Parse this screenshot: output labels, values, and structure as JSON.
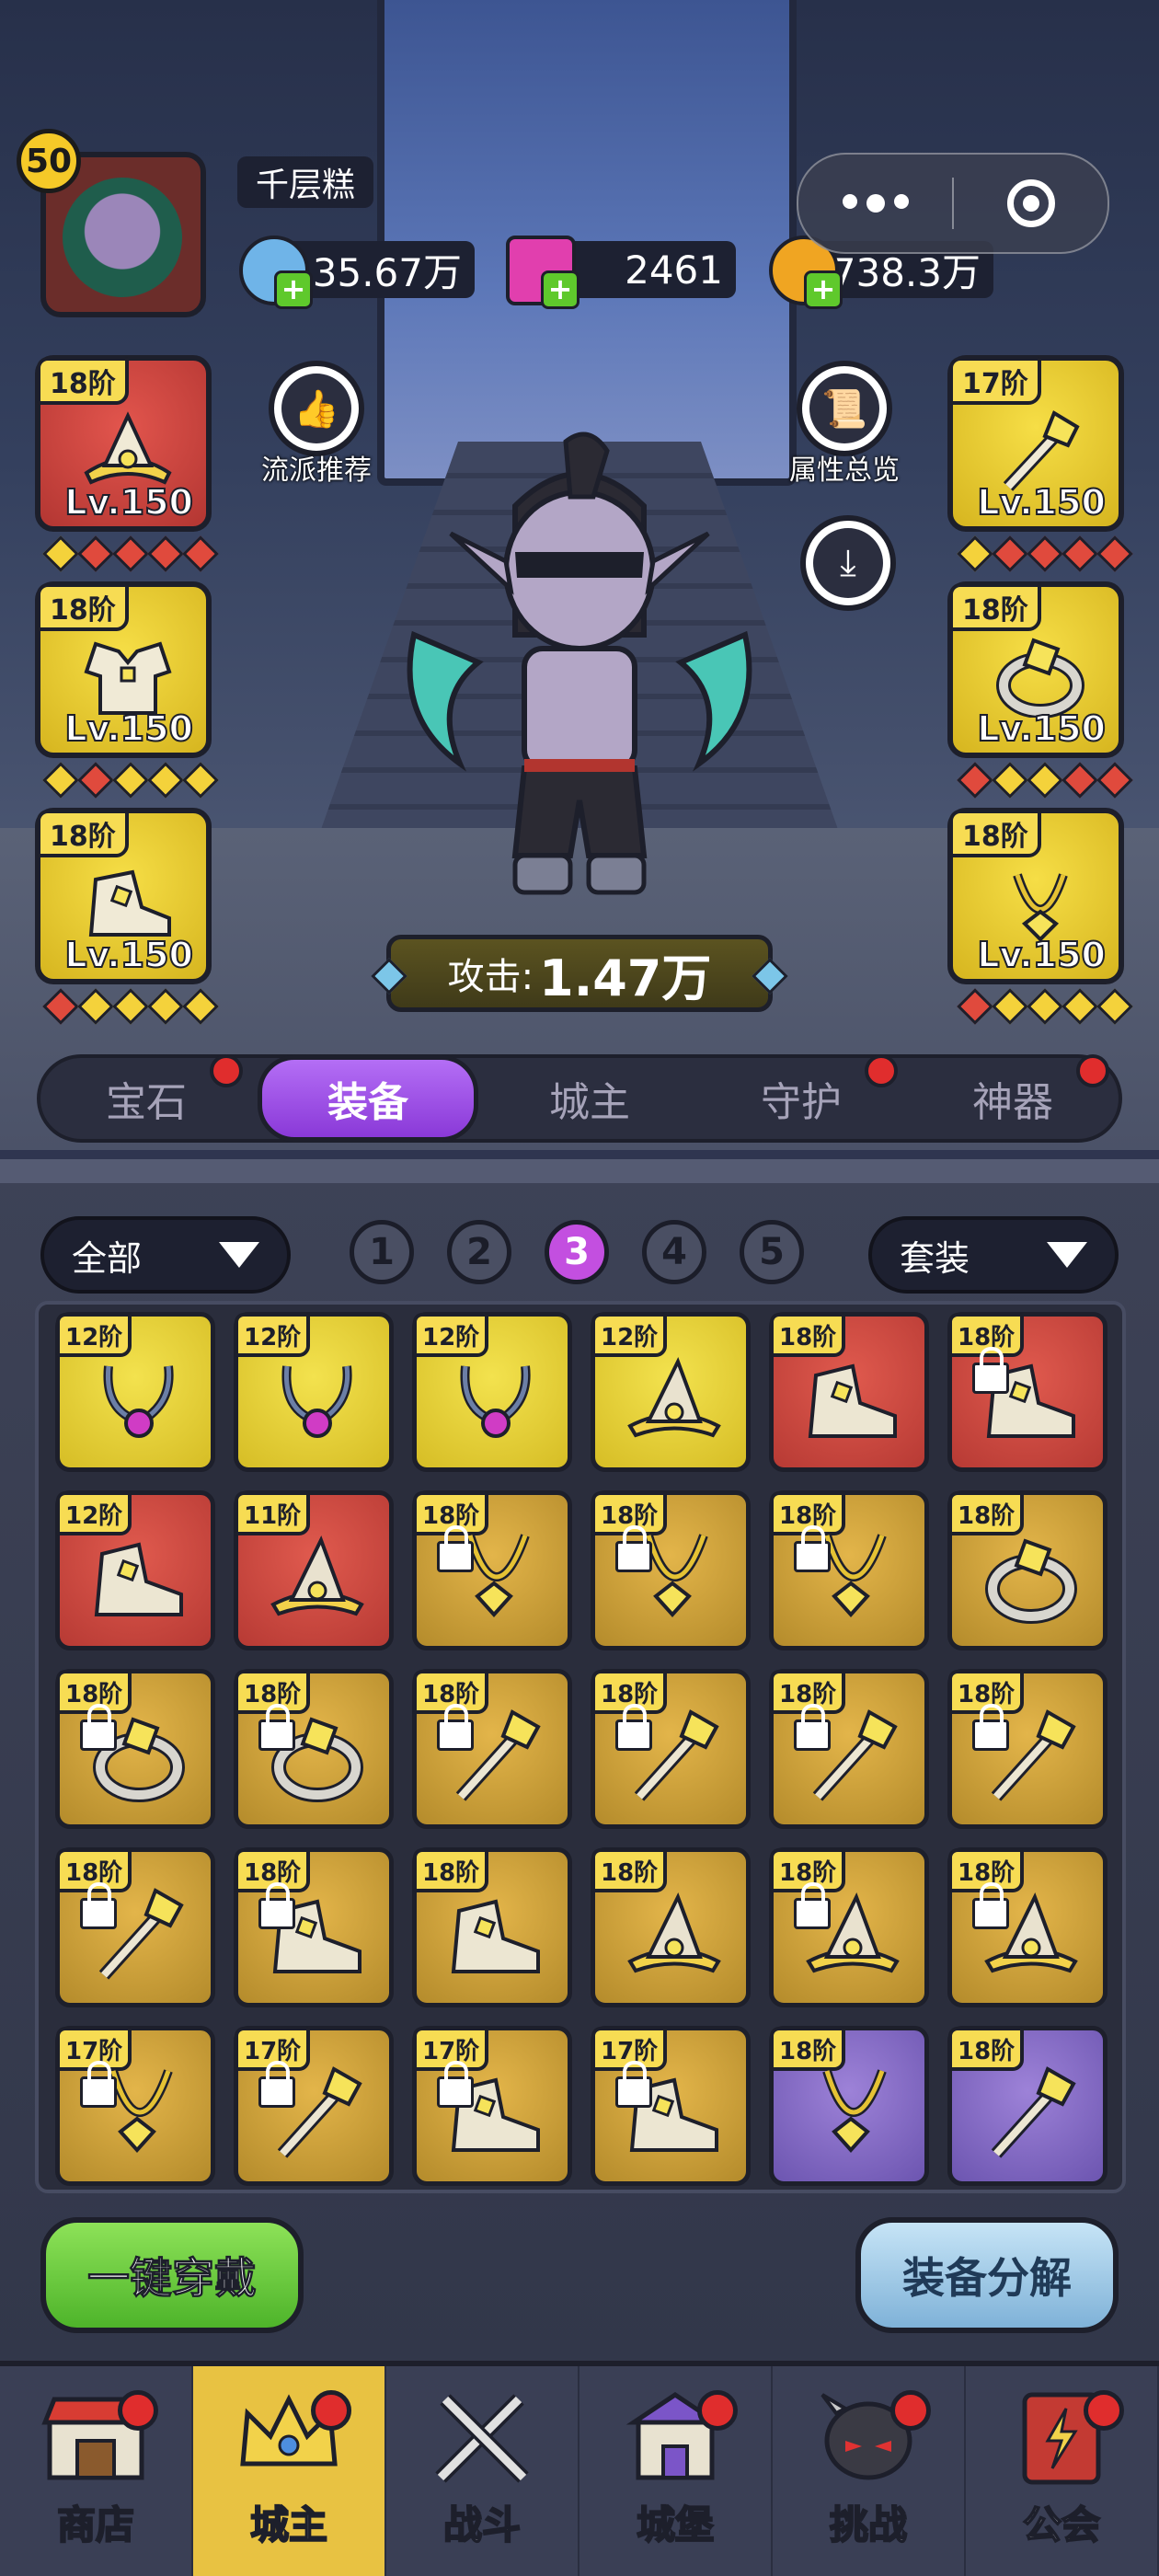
{
  "player": {
    "level": "50",
    "name": "千层糕"
  },
  "currencies": [
    {
      "name": "crystal",
      "value": "35.67万",
      "icon": "crystal-icon",
      "color": "#6fb4e8"
    },
    {
      "name": "gem",
      "value": "2461",
      "icon": "pink-gem-icon",
      "color": "#e13fae"
    },
    {
      "name": "gold",
      "value": "738.3万",
      "icon": "gold-coin-icon",
      "color": "#f0a522"
    }
  ],
  "buttons": {
    "recommend": "流派推荐",
    "attributes": "属性总览"
  },
  "left_slots": [
    {
      "tier": "18阶",
      "level": "Lv.150",
      "color": "red",
      "icon": "hat-icon",
      "gems": [
        "y",
        "r",
        "r",
        "r",
        "r"
      ]
    },
    {
      "tier": "18阶",
      "level": "Lv.150",
      "color": "yellow",
      "icon": "armor-icon",
      "gems": [
        "y",
        "r",
        "y",
        "y",
        "y"
      ]
    },
    {
      "tier": "18阶",
      "level": "Lv.150",
      "color": "yellow",
      "icon": "boots-icon",
      "gems": [
        "r",
        "y",
        "y",
        "y",
        "y"
      ]
    }
  ],
  "right_slots": [
    {
      "tier": "17阶",
      "level": "Lv.150",
      "color": "yellow",
      "icon": "staff-icon",
      "gems": [
        "y",
        "r",
        "r",
        "r",
        "r"
      ]
    },
    {
      "tier": "18阶",
      "level": "Lv.150",
      "color": "yellow",
      "icon": "ring-icon",
      "gems": [
        "r",
        "y",
        "y",
        "r",
        "r"
      ]
    },
    {
      "tier": "18阶",
      "level": "Lv.150",
      "color": "yellow",
      "icon": "necklace-icon",
      "gems": [
        "r",
        "y",
        "y",
        "y",
        "y"
      ]
    }
  ],
  "attack": {
    "label": "攻击:",
    "value": "1.47万"
  },
  "tabs": [
    {
      "label": "宝石",
      "active": false,
      "dot": true
    },
    {
      "label": "装备",
      "active": true,
      "dot": false
    },
    {
      "label": "城主",
      "active": false,
      "dot": false
    },
    {
      "label": "守护",
      "active": false,
      "dot": true
    },
    {
      "label": "神器",
      "active": false,
      "dot": true
    }
  ],
  "filters": {
    "left": "全部",
    "right": "套装"
  },
  "pages": [
    "1",
    "2",
    "3",
    "4",
    "5"
  ],
  "active_page": "3",
  "inventory": [
    {
      "tier": "12阶",
      "color": "yellow",
      "icon": "pendant-icon",
      "lock": false
    },
    {
      "tier": "12阶",
      "color": "yellow",
      "icon": "pendant-icon",
      "lock": false
    },
    {
      "tier": "12阶",
      "color": "yellow",
      "icon": "pendant-icon",
      "lock": false
    },
    {
      "tier": "12阶",
      "color": "yellow",
      "icon": "hat-icon",
      "lock": false
    },
    {
      "tier": "18阶",
      "color": "red",
      "icon": "boots-icon",
      "lock": false
    },
    {
      "tier": "18阶",
      "color": "red",
      "icon": "boots-icon",
      "lock": true
    },
    {
      "tier": "12阶",
      "color": "red",
      "icon": "boots-icon",
      "lock": false
    },
    {
      "tier": "11阶",
      "color": "red",
      "icon": "hat-icon",
      "lock": false
    },
    {
      "tier": "18阶",
      "color": "gold",
      "icon": "necklace-icon",
      "lock": true
    },
    {
      "tier": "18阶",
      "color": "gold",
      "icon": "necklace-icon",
      "lock": true
    },
    {
      "tier": "18阶",
      "color": "gold",
      "icon": "necklace-icon",
      "lock": true
    },
    {
      "tier": "18阶",
      "color": "gold",
      "icon": "ring-icon",
      "lock": false
    },
    {
      "tier": "18阶",
      "color": "gold",
      "icon": "ring-icon",
      "lock": true
    },
    {
      "tier": "18阶",
      "color": "gold",
      "icon": "ring-icon",
      "lock": true
    },
    {
      "tier": "18阶",
      "color": "gold",
      "icon": "staff-icon",
      "lock": true
    },
    {
      "tier": "18阶",
      "color": "gold",
      "icon": "staff-icon",
      "lock": true
    },
    {
      "tier": "18阶",
      "color": "gold",
      "icon": "staff-icon",
      "lock": true
    },
    {
      "tier": "18阶",
      "color": "gold",
      "icon": "staff-icon",
      "lock": true
    },
    {
      "tier": "18阶",
      "color": "gold",
      "icon": "staff-icon",
      "lock": true
    },
    {
      "tier": "18阶",
      "color": "gold",
      "icon": "boots-icon",
      "lock": true
    },
    {
      "tier": "18阶",
      "color": "gold",
      "icon": "boots-icon",
      "lock": false
    },
    {
      "tier": "18阶",
      "color": "gold",
      "icon": "hat-icon",
      "lock": false
    },
    {
      "tier": "18阶",
      "color": "gold",
      "icon": "hat-icon",
      "lock": true
    },
    {
      "tier": "18阶",
      "color": "gold",
      "icon": "hat-icon",
      "lock": true
    },
    {
      "tier": "17阶",
      "color": "gold",
      "icon": "necklace-icon",
      "lock": true
    },
    {
      "tier": "17阶",
      "color": "gold",
      "icon": "staff-icon",
      "lock": true
    },
    {
      "tier": "17阶",
      "color": "gold",
      "icon": "boots-icon",
      "lock": true
    },
    {
      "tier": "17阶",
      "color": "gold",
      "icon": "boots-icon",
      "lock": true
    },
    {
      "tier": "18阶",
      "color": "purple",
      "icon": "necklace-icon",
      "lock": false
    },
    {
      "tier": "18阶",
      "color": "purple",
      "icon": "staff-icon",
      "lock": false
    }
  ],
  "actions": {
    "equip_all": "一键穿戴",
    "decompose": "装备分解"
  },
  "nav": [
    {
      "label": "商店",
      "icon": "shop-icon",
      "active": false,
      "dot": true
    },
    {
      "label": "城主",
      "icon": "crown-icon",
      "active": true,
      "dot": true
    },
    {
      "label": "战斗",
      "icon": "crossed-swords-icon",
      "active": false,
      "dot": false
    },
    {
      "label": "城堡",
      "icon": "castle-icon",
      "active": false,
      "dot": true
    },
    {
      "label": "挑战",
      "icon": "demon-helmet-icon",
      "active": false,
      "dot": true
    },
    {
      "label": "公会",
      "icon": "guild-book-icon",
      "active": false,
      "dot": true
    }
  ]
}
